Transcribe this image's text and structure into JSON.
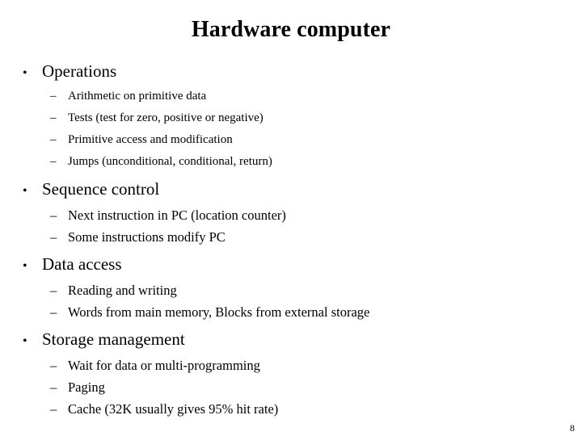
{
  "slide": {
    "title": "Hardware computer",
    "page_number": "8",
    "bullet_marker": "•",
    "dash_marker": "–",
    "groups": [
      {
        "heading": "Operations",
        "items": [
          "Arithmetic on primitive data",
          "Tests (test for zero, positive or negative)",
          "Primitive access and modification",
          "Jumps (unconditional, conditional, return)"
        ]
      },
      {
        "heading": "Sequence control",
        "items": [
          "Next instruction in PC (location counter)",
          "Some instructions modify PC"
        ]
      },
      {
        "heading": "Data access",
        "items": [
          "Reading and writing",
          "Words from main memory, Blocks from external storage"
        ]
      },
      {
        "heading": "Storage management",
        "items": [
          "Wait for data or multi-programming",
          "Paging",
          "Cache (32K usually gives 95% hit rate)"
        ]
      }
    ]
  }
}
